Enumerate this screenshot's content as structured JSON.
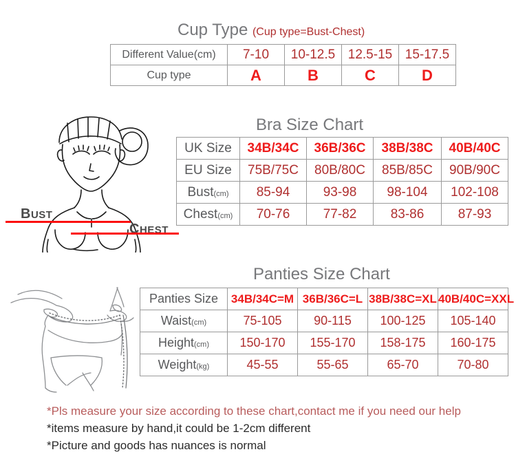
{
  "cup_section": {
    "title": "Cup Type",
    "subtitle": "(Cup type=Bust-Chest)",
    "rows": [
      {
        "label": "Different Value(cm)",
        "values": [
          "7-10",
          "10-12.5",
          "12.5-15",
          "15-17.5"
        ]
      },
      {
        "label": "Cup type",
        "values": [
          "A",
          "B",
          "C",
          "D"
        ]
      }
    ]
  },
  "bra_section": {
    "title": "Bra Size Chart",
    "rows": [
      {
        "label": "UK Size",
        "unit": "",
        "values": [
          "34B/34C",
          "36B/36C",
          "38B/38C",
          "40B/40C"
        ]
      },
      {
        "label": "EU Size",
        "unit": "",
        "values": [
          "75B/75C",
          "80B/80C",
          "85B/85C",
          "90B/90C"
        ]
      },
      {
        "label": "Bust",
        "unit": "(cm)",
        "values": [
          "85-94",
          "93-98",
          "98-104",
          "102-108"
        ]
      },
      {
        "label": "Chest",
        "unit": "(cm)",
        "values": [
          "70-76",
          "77-82",
          "83-86",
          "87-93"
        ]
      }
    ]
  },
  "panties_section": {
    "title": "Panties Size Chart",
    "rows": [
      {
        "label": "Panties Size",
        "unit": "",
        "values": [
          "34B/34C=M",
          "36B/36C=L",
          "38B/38C=XL",
          "40B/40C=XXL"
        ]
      },
      {
        "label": "Waist",
        "unit": "(cm)",
        "values": [
          "75-105",
          "90-115",
          "100-125",
          "105-140"
        ]
      },
      {
        "label": "Height",
        "unit": "(cm)",
        "values": [
          "150-170",
          "155-170",
          "158-175",
          "160-175"
        ]
      },
      {
        "label": "Weight",
        "unit": "(kg)",
        "values": [
          "45-55",
          "55-65",
          "65-70",
          "70-80"
        ]
      }
    ]
  },
  "illustration": {
    "bust_label": "Bust",
    "chest_label": "Chest",
    "upper_body_icon": "female-torso-illustration",
    "lower_body_icon": "waist-measuring-illustration",
    "measure_line_color": "#fc0d0d"
  },
  "notes": [
    "*Pls measure your size according to these chart,contact me if you need our help",
    "*items measure by hand,it could be 1-2cm different",
    "*Picture and goods has nuances is normal"
  ],
  "colors": {
    "title_gray": "#77787b",
    "label_gray": "#58595b",
    "value_bright_red": "#ee1c1c",
    "value_dark_red": "#b03030",
    "border_gray": "#9a9a9a"
  }
}
